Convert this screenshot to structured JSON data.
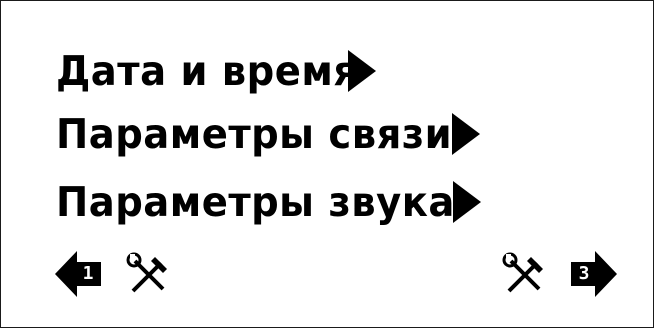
{
  "menu": {
    "items": [
      {
        "label": "Дата и время"
      },
      {
        "label": "Параметры связи"
      },
      {
        "label": "Параметры звука"
      }
    ]
  },
  "footer": {
    "prev_page": "1",
    "next_page": "3"
  },
  "icons": {
    "item_arrow": "triangle-right-icon",
    "prev": "arrow-left-icon",
    "next": "arrow-right-icon",
    "tools": "wrench-hammer-icon"
  },
  "colors": {
    "foreground": "#000000",
    "background": "#ffffff"
  }
}
